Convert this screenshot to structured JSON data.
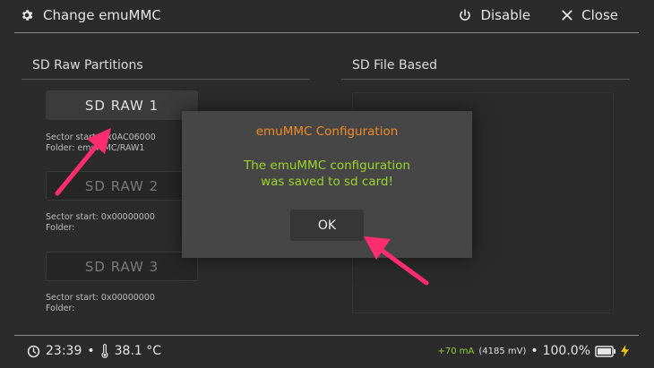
{
  "header": {
    "title": "Change emuMMC",
    "disable_label": "Disable",
    "close_label": "Close"
  },
  "left_section": {
    "title": "SD Raw Partitions",
    "partitions": [
      {
        "label": "SD RAW 1",
        "sector_label": "Sector start: 0x0AC06000",
        "folder_label": "Folder: emuMMC/RAW1",
        "enabled": true
      },
      {
        "label": "SD RAW 2",
        "sector_label": "Sector start: 0x00000000",
        "folder_label": "Folder:",
        "enabled": false
      },
      {
        "label": "SD RAW 3",
        "sector_label": "Sector start: 0x00000000",
        "folder_label": "Folder:",
        "enabled": false
      }
    ]
  },
  "right_section": {
    "title": "SD File Based"
  },
  "dialog": {
    "title": "emuMMC Configuration",
    "message_line1": "The emuMMC configuration",
    "message_line2": "was saved to sd card!",
    "ok_label": "OK"
  },
  "status_bar": {
    "time": "23:39",
    "separator": "•",
    "temperature": "38.1 °C",
    "current": "+70 mA",
    "voltage": "(4185 mV)",
    "battery_percent": "100.0%"
  },
  "colors": {
    "background": "#2b2b2b",
    "dialog_bg": "#464646",
    "dialog_title": "#f08a24",
    "dialog_message": "#9cd42a",
    "annotation_arrow": "#ff2d6f"
  },
  "icons": [
    "gear-icon",
    "power-icon",
    "close-icon",
    "clock-icon",
    "thermometer-icon",
    "battery-icon",
    "charging-bolt-icon"
  ]
}
